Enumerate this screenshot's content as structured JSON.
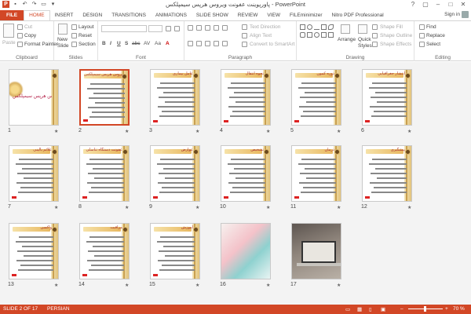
{
  "window": {
    "title": "پاورپوینت عفونت ویروس هرپس سیمپلکس - PowerPoint",
    "app_logo": "P",
    "controls": [
      "?",
      "▢",
      "–",
      "□",
      "✕"
    ]
  },
  "ribbon_tabs": [
    "FILE",
    "HOME",
    "INSERT",
    "DESIGN",
    "TRANSITIONS",
    "ANIMATIONS",
    "SLIDE SHOW",
    "REVIEW",
    "VIEW",
    "FILEminimizer",
    "Nitro PDF Professional"
  ],
  "active_tab": "HOME",
  "account": {
    "signin": "Sign in"
  },
  "ribbon": {
    "clipboard": {
      "label": "Clipboard",
      "paste": "Paste",
      "cut": "Cut",
      "copy": "Copy",
      "format_painter": "Format Painter"
    },
    "slides": {
      "label": "Slides",
      "new_slide": "New",
      "new_slide2": "Slide",
      "layout": "Layout",
      "reset": "Reset",
      "section": "Section"
    },
    "font": {
      "label": "Font",
      "b": "B",
      "i": "I",
      "u": "U",
      "s": "S",
      "abc": "abc",
      "av": "AV",
      "aa": "Aa",
      "a": "A"
    },
    "paragraph": {
      "label": "Paragraph",
      "text_direction": "Text Direction",
      "align_text": "Align Text",
      "convert_smartart": "Convert to SmartArt"
    },
    "drawing": {
      "label": "Drawing",
      "arrange": "Arrange",
      "quick_styles": "Quick",
      "quick_styles2": "Styles",
      "shape_fill": "Shape Fill",
      "shape_outline": "Shape Outline",
      "shape_effects": "Shape Effects"
    },
    "editing": {
      "label": "Editing",
      "find": "Find",
      "replace": "Replace",
      "select": "Select"
    }
  },
  "slides": [
    {
      "num": "1",
      "title": "عفونت ویروس هرپس سیمپلکس",
      "style": "cover"
    },
    {
      "num": "2",
      "title": "تاریخچه ویروس هرپس سیمپلکس",
      "style": "text",
      "selected": true
    },
    {
      "num": "3",
      "title": "عامل بیماری",
      "style": "text"
    },
    {
      "num": "4",
      "title": "نحوه انتقال",
      "style": "text"
    },
    {
      "num": "5",
      "title": "دوره کمون",
      "style": "text"
    },
    {
      "num": "6",
      "title": "انتشار جغرافیایی",
      "style": "text"
    },
    {
      "num": "7",
      "title": "علائم بالینی",
      "style": "text"
    },
    {
      "num": "8",
      "title": "عفونت دستگاه تناسلی",
      "style": "text"
    },
    {
      "num": "9",
      "title": "عوارض",
      "style": "text"
    },
    {
      "num": "10",
      "title": "تشخیص",
      "style": "text"
    },
    {
      "num": "11",
      "title": "درمان",
      "style": "text"
    },
    {
      "num": "12",
      "title": "پیشگیری",
      "style": "text"
    },
    {
      "num": "13",
      "title": "واکسن",
      "style": "text"
    },
    {
      "num": "14",
      "title": "مراقبت",
      "style": "text"
    },
    {
      "num": "15",
      "title": "آموزش",
      "style": "text"
    },
    {
      "num": "16",
      "title": "",
      "style": "photo1"
    },
    {
      "num": "17",
      "title": "",
      "style": "photo2"
    }
  ],
  "status": {
    "slide_info": "SLIDE 2 OF 17",
    "language": "PERSIAN",
    "zoom": "70 %"
  }
}
